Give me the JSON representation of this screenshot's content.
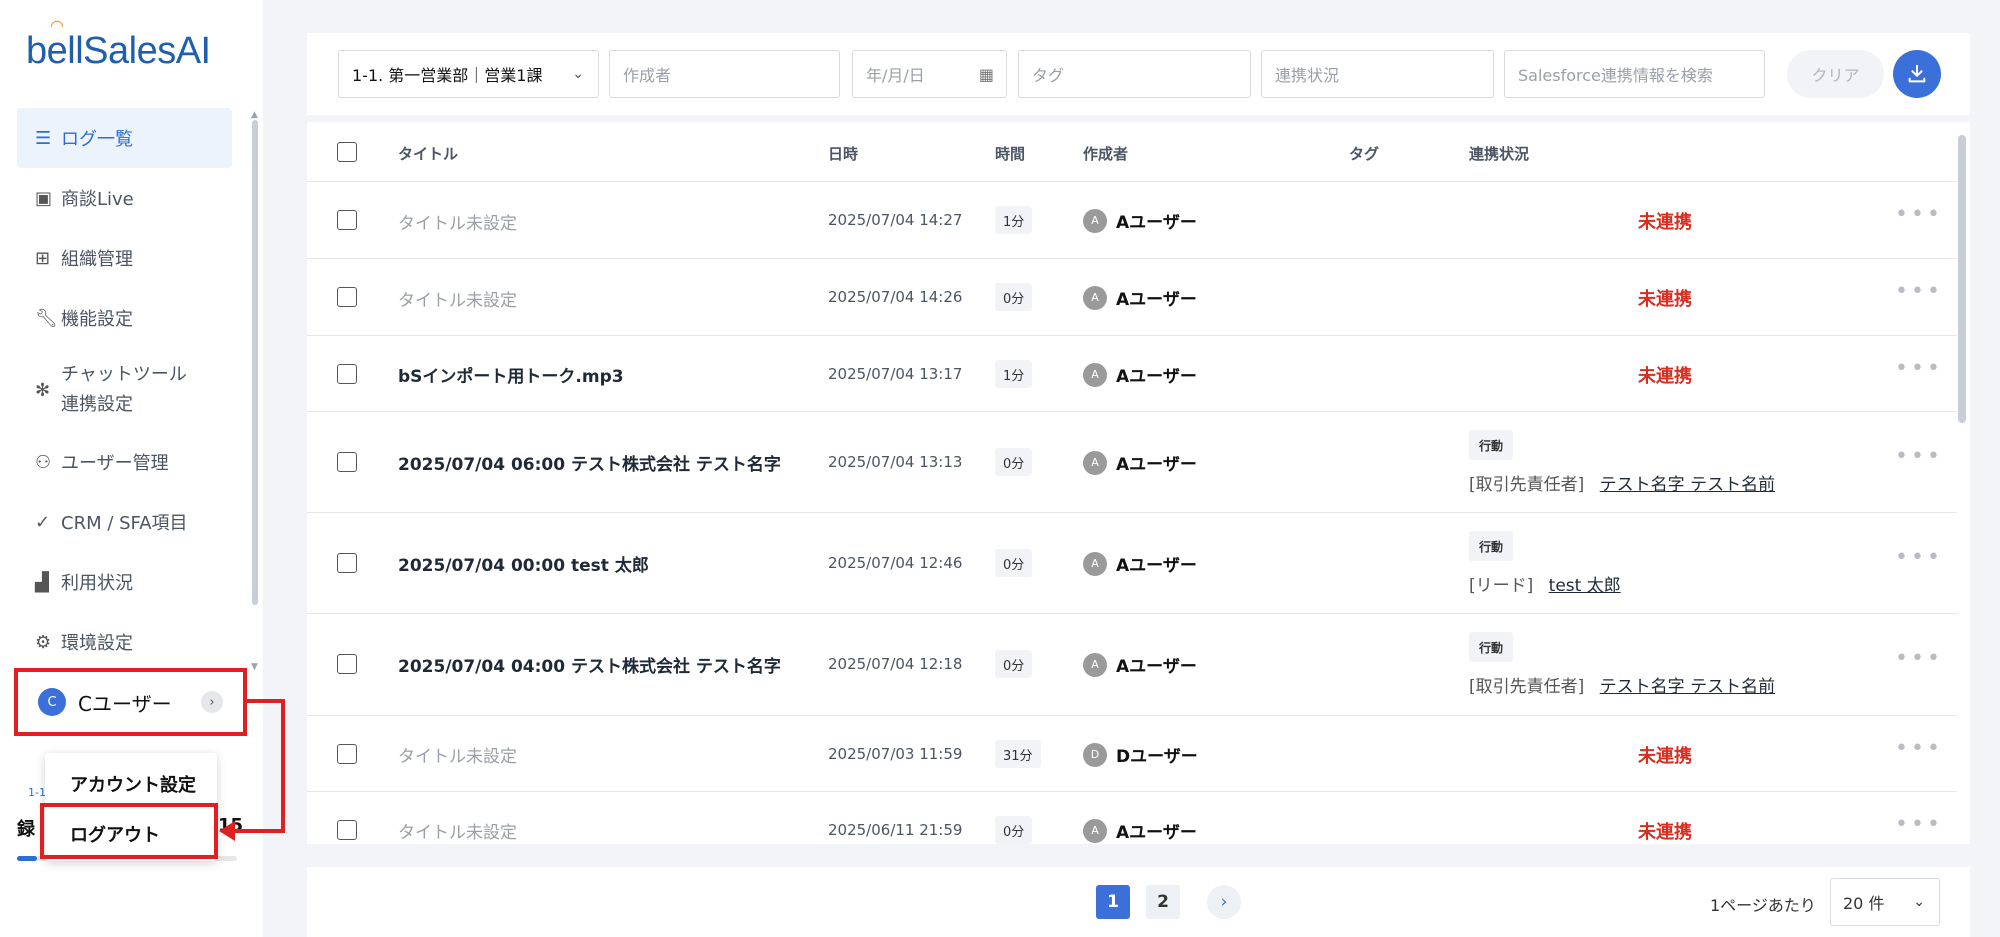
{
  "app": {
    "logo": "bellSalesAI"
  },
  "sidebar": {
    "items": [
      {
        "label": "ログ一覧",
        "icon": "list-icon",
        "active": true
      },
      {
        "label": "商談Live",
        "icon": "live-icon"
      },
      {
        "label": "組織管理",
        "icon": "grid-icon"
      },
      {
        "label": "機能設定",
        "icon": "wrench-icon"
      },
      {
        "label": "チャットツール",
        "label2": "連携設定",
        "icon": "network-icon"
      },
      {
        "label": "ユーザー管理",
        "icon": "users-icon"
      },
      {
        "label": "CRM / SFA項目",
        "icon": "check-icon"
      },
      {
        "label": "利用状況",
        "icon": "bar-chart-icon"
      },
      {
        "label": "環境設定",
        "icon": "gear-icon"
      }
    ],
    "user": {
      "initial": "C",
      "name": "Cユーザー"
    },
    "behind": {
      "text1": "1-1",
      "text2": "録",
      "text3": "15"
    },
    "usage_fraction": 0.09
  },
  "user_menu": {
    "account": "アカウント設定",
    "logout": "ログアウト"
  },
  "filters": {
    "department": "1-1. 第一営業部｜営業1課",
    "author_placeholder": "作成者",
    "date_placeholder": "年/月/日",
    "tag_placeholder": "タグ",
    "status_placeholder": "連携状況",
    "salesforce_placeholder": "Salesforce連携情報を検索",
    "clear": "クリア"
  },
  "table": {
    "headers": {
      "title": "タイトル",
      "date": "日時",
      "duration": "時間",
      "author": "作成者",
      "tag": "タグ",
      "status": "連携状況"
    },
    "rows": [
      {
        "title": "タイトル未設定",
        "muted": true,
        "date": "2025/07/04 14:27",
        "duration": "1分",
        "avatar": "A",
        "author": "Aユーザー",
        "status": "未連携"
      },
      {
        "title": "タイトル未設定",
        "muted": true,
        "date": "2025/07/04 14:26",
        "duration": "0分",
        "avatar": "A",
        "author": "Aユーザー",
        "status": "未連携"
      },
      {
        "title": "bSインポート用トーク.mp3",
        "muted": false,
        "date": "2025/07/04 13:17",
        "duration": "1分",
        "avatar": "A",
        "author": "Aユーザー",
        "status": "未連携"
      },
      {
        "title": "2025/07/04 06:00 テスト株式会社 テスト名字",
        "muted": false,
        "date": "2025/07/04 13:13",
        "duration": "0分",
        "avatar": "A",
        "author": "Aユーザー",
        "badge": "行動",
        "link_type": "[取引先責任者]",
        "link_name": "テスト名字 テスト名前"
      },
      {
        "title": "2025/07/04 00:00 test 太郎",
        "muted": false,
        "date": "2025/07/04 12:46",
        "duration": "0分",
        "avatar": "A",
        "author": "Aユーザー",
        "badge": "行動",
        "link_type": "[リード]",
        "link_name": "test 太郎"
      },
      {
        "title": "2025/07/04 04:00 テスト株式会社 テスト名字",
        "muted": false,
        "date": "2025/07/04 12:18",
        "duration": "0分",
        "avatar": "A",
        "author": "Aユーザー",
        "badge": "行動",
        "link_type": "[取引先責任者]",
        "link_name": "テスト名字 テスト名前"
      },
      {
        "title": "タイトル未設定",
        "muted": true,
        "date": "2025/07/03 11:59",
        "duration": "31分",
        "avatar": "D",
        "author": "Dユーザー",
        "status": "未連携"
      },
      {
        "title": "タイトル未設定",
        "muted": true,
        "date": "2025/06/11 21:59",
        "duration": "0分",
        "avatar": "A",
        "author": "Aユーザー",
        "status": "未連携"
      }
    ]
  },
  "pagination": {
    "pages": [
      "1",
      "2"
    ],
    "current": "1",
    "per_page_label": "1ページあたり",
    "per_page_value": "20 件"
  },
  "colors": {
    "accent": "#3b6fd9",
    "error": "#d92d20",
    "highlight": "#e02020"
  }
}
